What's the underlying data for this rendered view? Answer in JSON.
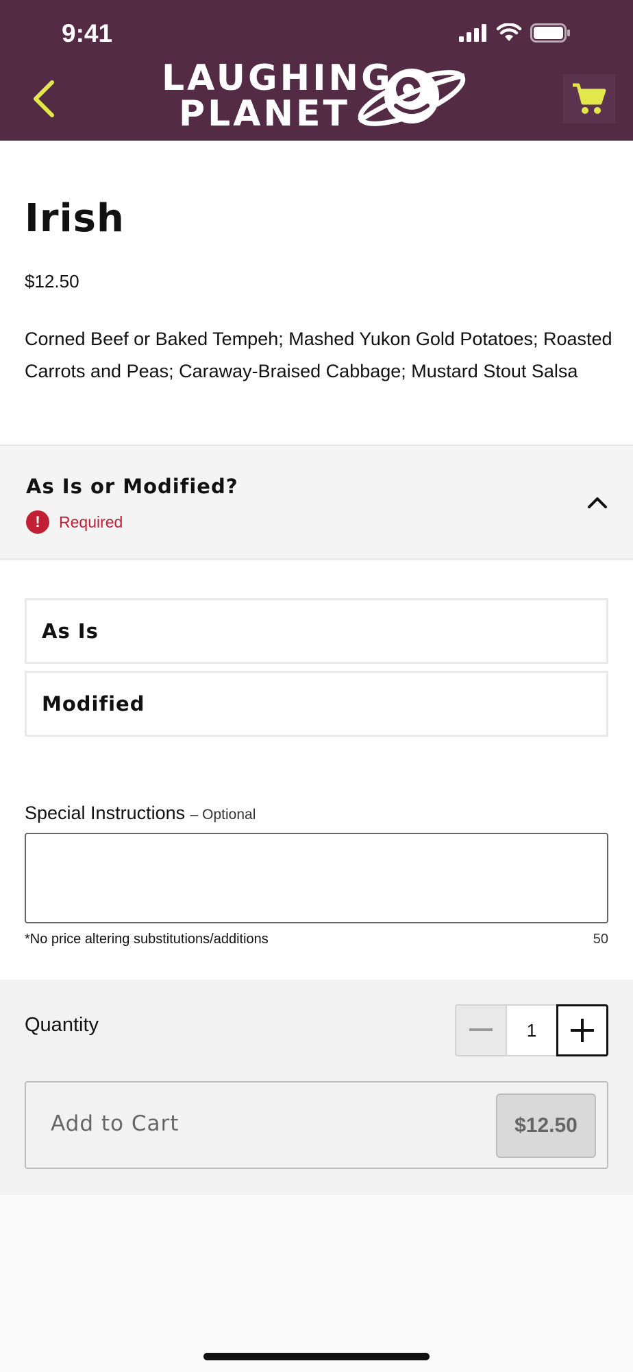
{
  "status_bar": {
    "time": "9:41"
  },
  "header": {
    "logo_line1": "LAUGHING",
    "logo_line2": "PLANET",
    "back_icon": "chevron-left-icon",
    "cart_icon": "cart-icon",
    "accent_color": "#e2e84a",
    "background_color": "#532b45"
  },
  "item": {
    "name": "Irish",
    "price": "$12.50",
    "description": "Corned Beef or Baked Tempeh; Mashed Yukon Gold Potatoes; Roasted Carrots and Peas; Caraway-Braised Cabbage; Mustard Stout Salsa"
  },
  "modifier_group": {
    "title": "As Is or Modified?",
    "required_label": "Required",
    "required_color": "#c01f34",
    "expanded": true,
    "options": [
      {
        "label": "As Is"
      },
      {
        "label": "Modified"
      }
    ]
  },
  "special_instructions": {
    "label": "Special Instructions",
    "optional_label": "– Optional",
    "value": "",
    "note": "*No price altering substitutions/additions",
    "char_count": "50"
  },
  "quantity": {
    "label": "Quantity",
    "value": "1",
    "minus_symbol": "—"
  },
  "add_to_cart": {
    "label": "Add to Cart",
    "price": "$12.50"
  }
}
